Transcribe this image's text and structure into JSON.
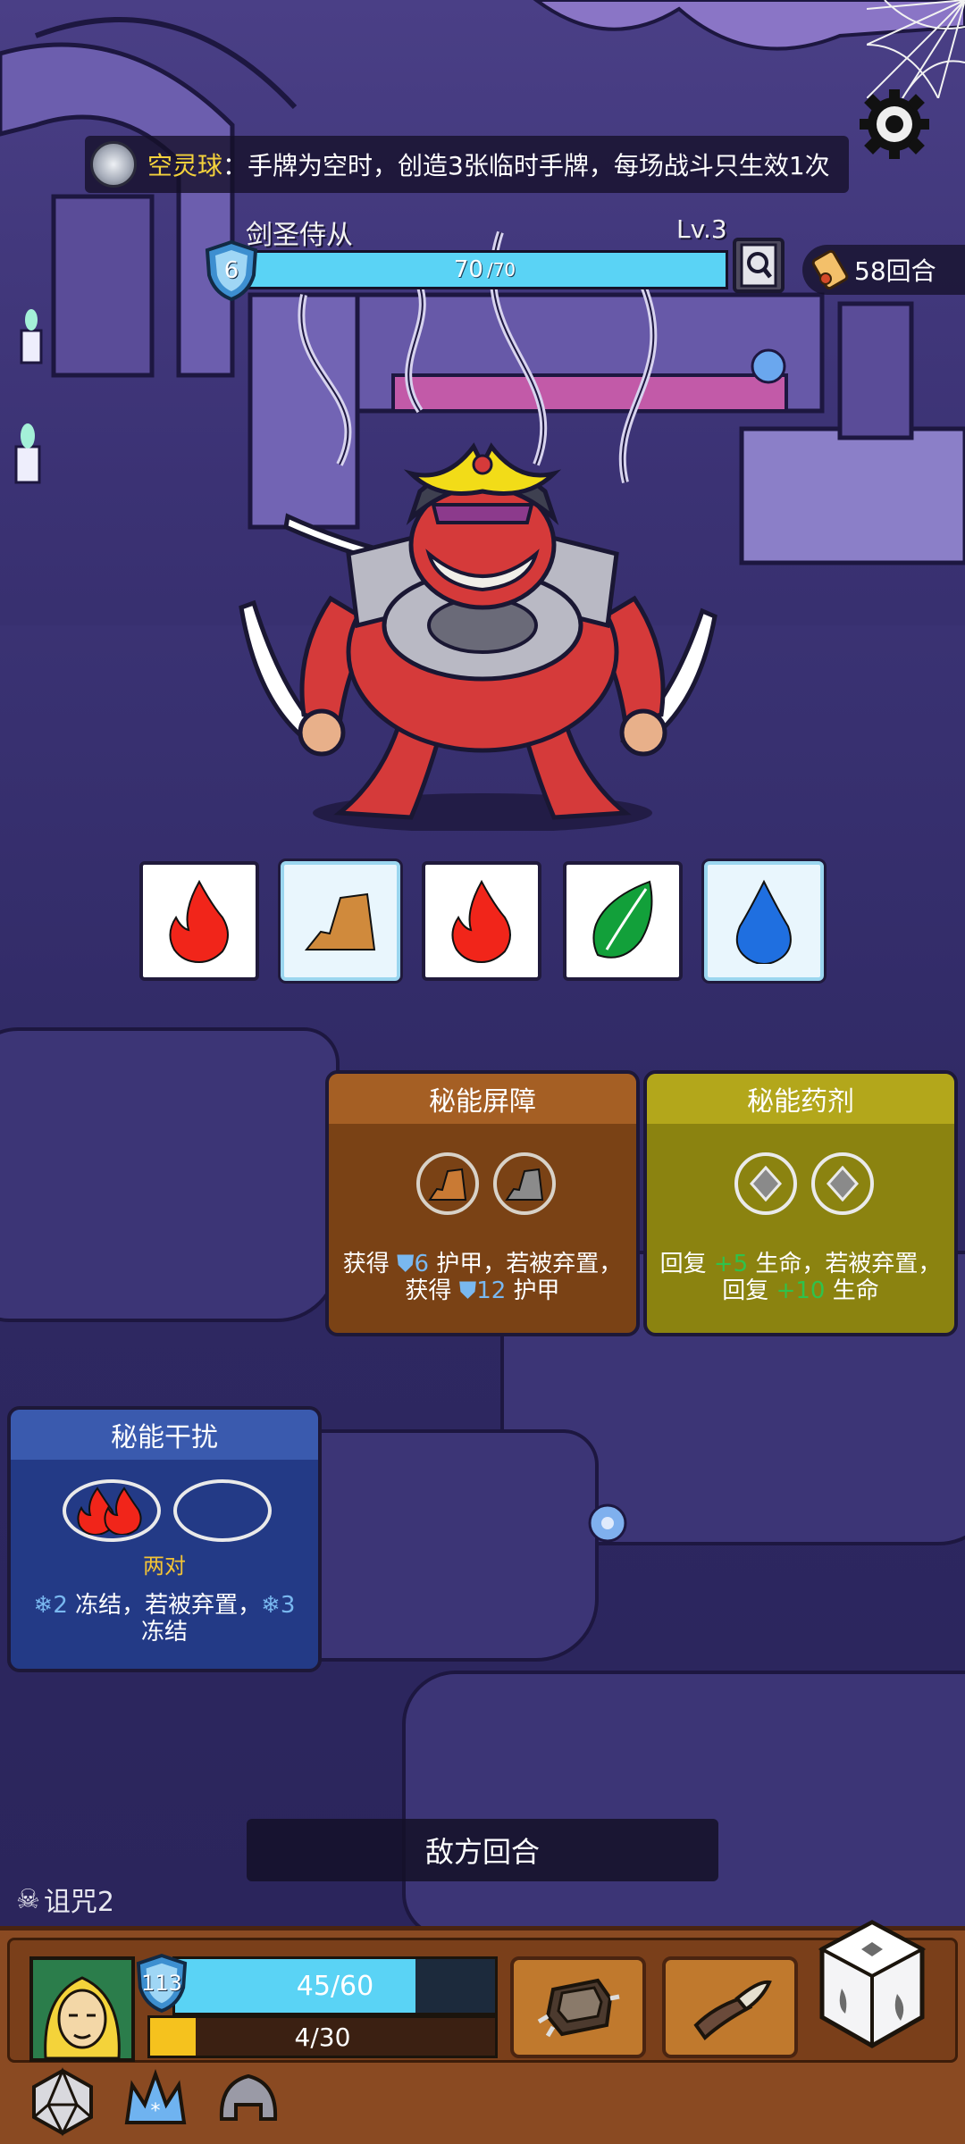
{
  "relic": {
    "name": "空灵球",
    "description": "：手牌为空时，创造3张临时手牌，每场战斗只生效1次",
    "icon": "swirl-orb-icon"
  },
  "enemy": {
    "name": "剑圣侍从",
    "level": "Lv.3",
    "shield": "6",
    "hp_current": "70",
    "hp_max": "/70",
    "hp_fraction": 1.0,
    "intents": [
      {
        "element": "fire",
        "frozen": false,
        "color": "#f1251a"
      },
      {
        "element": "earth",
        "frozen": true,
        "color": "#d08a3c"
      },
      {
        "element": "fire",
        "frozen": false,
        "color": "#f1251a"
      },
      {
        "element": "wind",
        "frozen": false,
        "color": "#12a03a"
      },
      {
        "element": "water",
        "frozen": true,
        "color": "#1f6fe0"
      }
    ]
  },
  "turn_counter": "58回合",
  "cards": [
    {
      "title": "秘能屏障",
      "line1_a": "获得 ",
      "line1_val": "6",
      "line1_b": " 护甲，若被弃置，",
      "line2_a": "获得 ",
      "line2_val": "12",
      "line2_b": " 护甲"
    },
    {
      "title": "秘能药剂",
      "line1_a": "回复 ",
      "line1_val": "+5",
      "line1_b": " 生命，若被弃置，",
      "line2_a": "回复 ",
      "line2_val": "+10",
      "line2_b": " 生命"
    },
    {
      "title": "秘能干扰",
      "requirement": "两对",
      "line1_val": "2",
      "line1_b": " 冻结，若被弃置，",
      "line1_val2": "3",
      "line2": "冻结"
    }
  ],
  "enemy_turn_label": "敌方回合",
  "curse": {
    "label": "诅咒2",
    "icon": "skull-icon"
  },
  "player": {
    "shield": "113",
    "hp": "45/60",
    "hp_fraction": 0.75,
    "xp": "4/30",
    "xp_fraction": 0.133
  },
  "colors": {
    "accent_cyan": "#5ad3f5",
    "gold": "#f4d23c",
    "panel_brown": "#8a4a22"
  }
}
